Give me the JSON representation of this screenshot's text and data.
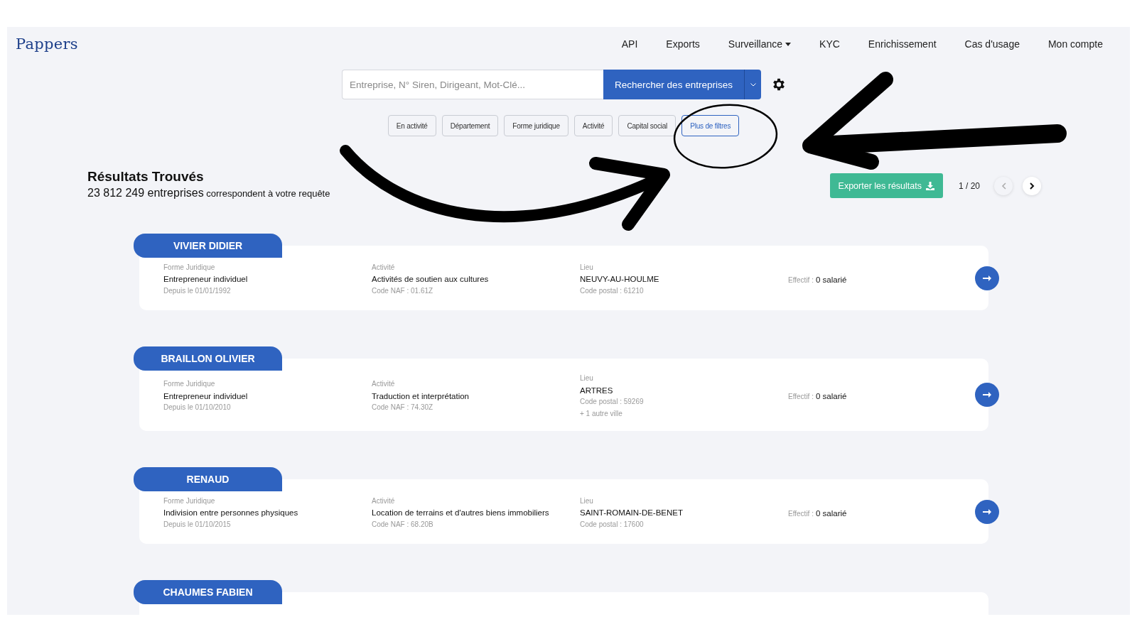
{
  "logo": "Pappers",
  "nav": [
    {
      "label": "API",
      "dropdown": false
    },
    {
      "label": "Exports",
      "dropdown": false
    },
    {
      "label": "Surveillance",
      "dropdown": true
    },
    {
      "label": "KYC",
      "dropdown": false
    },
    {
      "label": "Enrichissement",
      "dropdown": false
    },
    {
      "label": "Cas d'usage",
      "dropdown": false
    },
    {
      "label": "Mon compte",
      "dropdown": false
    }
  ],
  "search": {
    "placeholder": "Entreprise, N° Siren, Dirigeant, Mot-Clé...",
    "button": "Rechercher des entreprises"
  },
  "filters": [
    {
      "label": "En activité",
      "selected": false
    },
    {
      "label": "Département",
      "selected": false
    },
    {
      "label": "Forme juridique",
      "selected": false
    },
    {
      "label": "Activité",
      "selected": false
    },
    {
      "label": "Capital social",
      "selected": false
    },
    {
      "label": "Plus de filtres",
      "selected": true
    }
  ],
  "results": {
    "title": "Résultats Trouvés",
    "count": "23 812 249 entreprises",
    "suffix": "correspondent à votre requête",
    "export": "Exporter les résultats",
    "page": "1 / 20"
  },
  "companies": [
    {
      "name": "VIVIER DIDIER",
      "forme_label": "Forme Juridique",
      "forme": "Entrepreneur individuel",
      "depuis": "Depuis le 01/01/1992",
      "activite_label": "Activité",
      "activite": "Activités de soutien aux cultures",
      "naf": "Code NAF : 01.61Z",
      "lieu_label": "Lieu",
      "lieu": "NEUVY-AU-HOULME",
      "code_postal": "Code postal : 61210",
      "effectif_label": "Effectif :",
      "effectif": "0 salarié"
    },
    {
      "name": "BRAILLON OLIVIER",
      "forme_label": "Forme Juridique",
      "forme": "Entrepreneur individuel",
      "depuis": "Depuis le 01/10/2010",
      "activite_label": "Activité",
      "activite": "Traduction et interprétation",
      "naf": "Code NAF : 74.30Z",
      "lieu_label": "Lieu",
      "lieu": "ARTRES",
      "code_postal": "Code postal : 59269",
      "extra": "+ 1 autre ville",
      "effectif_label": "Effectif :",
      "effectif": "0 salarié"
    },
    {
      "name": "RENAUD",
      "forme_label": "Forme Juridique",
      "forme": "Indivision entre personnes physiques",
      "depuis": "Depuis le 01/10/2015",
      "activite_label": "Activité",
      "activite": "Location de terrains et d'autres biens immobiliers",
      "naf": "Code NAF : 68.20B",
      "lieu_label": "Lieu",
      "lieu": "SAINT-ROMAIN-DE-BENET",
      "code_postal": "Code postal : 17600",
      "effectif_label": "Effectif :",
      "effectif": "0 salarié"
    },
    {
      "name": "CHAUMES FABIEN"
    }
  ]
}
